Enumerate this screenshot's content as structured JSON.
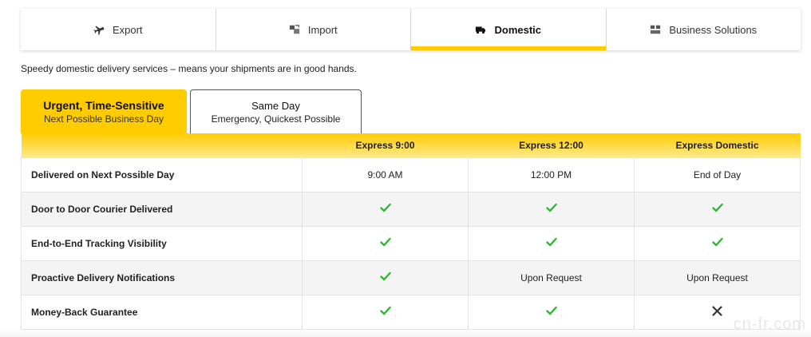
{
  "tabs": [
    {
      "label": "Export",
      "icon": "airplane-icon",
      "active": false
    },
    {
      "label": "Import",
      "icon": "import-icon",
      "active": false
    },
    {
      "label": "Domestic",
      "icon": "truck-icon",
      "active": true
    },
    {
      "label": "Business Solutions",
      "icon": "business-icon",
      "active": false
    }
  ],
  "intro": "Speedy domestic delivery services – means your shipments are in good hands.",
  "service_tabs": {
    "active": {
      "title": "Urgent, Time-Sensitive",
      "subtitle": "Next Possible Business Day"
    },
    "inactive": {
      "title": "Same Day",
      "subtitle": "Emergency, Quickest Possible"
    }
  },
  "table": {
    "columns": [
      "",
      "Express 9:00",
      "Express 12:00",
      "Express Domestic"
    ],
    "rows": [
      {
        "label": "Delivered on Next Possible Day",
        "values": [
          "9:00 AM",
          "12:00 PM",
          "End of Day"
        ]
      },
      {
        "label": "Door to Door Courier Delivered",
        "values": [
          "check",
          "check",
          "check"
        ]
      },
      {
        "label": "End-to-End Tracking Visibility",
        "values": [
          "check",
          "check",
          "check"
        ]
      },
      {
        "label": "Proactive Delivery Notifications",
        "values": [
          "check",
          "Upon Request",
          "Upon Request"
        ]
      },
      {
        "label": "Money-Back Guarantee",
        "values": [
          "check",
          "check",
          "cross"
        ]
      }
    ]
  },
  "watermark": "cn-fr.com",
  "colors": {
    "accent": "#ffcc00",
    "check": "#2eb82e",
    "cross": "#333333"
  }
}
